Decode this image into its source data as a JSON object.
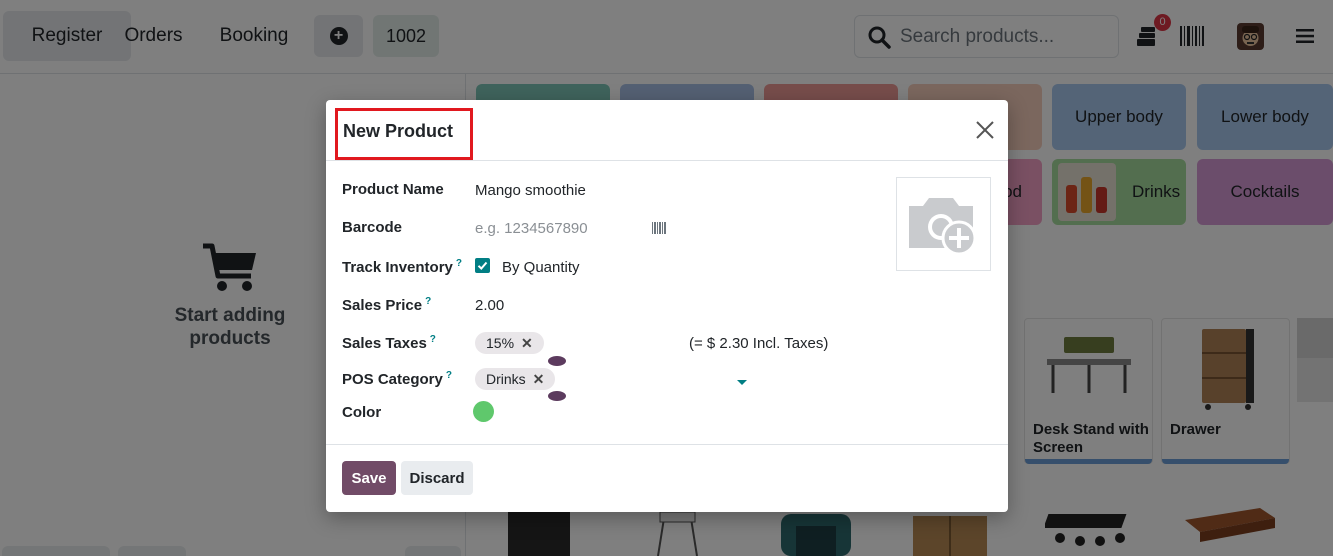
{
  "nav": {
    "register": "Register",
    "orders": "Orders",
    "booking": "Booking",
    "table_number": "1002",
    "search_placeholder": "Search products...",
    "order_badge": "0"
  },
  "cart": {
    "empty_line1": "Start adding",
    "empty_line2": "products"
  },
  "categories": {
    "upper_body": "Upper body",
    "lower_body": "Lower body",
    "food_partial": "od",
    "drinks": "Drinks",
    "cocktails": "Cocktails"
  },
  "products": {
    "desk_stand_line1": "Desk Stand with",
    "desk_stand_line2": "Screen",
    "drawer": "Drawer"
  },
  "modal": {
    "title": "New Product",
    "fields": {
      "product_name_label": "Product Name",
      "product_name_value": "Mango smoothie",
      "barcode_label": "Barcode",
      "barcode_placeholder": "e.g. 1234567890",
      "track_inventory_label": "Track Inventory",
      "track_inventory_option": "By Quantity",
      "track_inventory_checked": true,
      "sales_price_label": "Sales Price",
      "sales_price_value": "2.00",
      "sales_taxes_label": "Sales Taxes",
      "sales_taxes_tag": "15%",
      "incl_taxes_text": "(= $ 2.30 Incl. Taxes)",
      "pos_category_label": "POS Category",
      "pos_category_tag": "Drinks",
      "color_label": "Color",
      "color_value": "#5fc86c",
      "help_mark": "?",
      "tag_remove": "✕"
    },
    "save_label": "Save",
    "discard_label": "Discard"
  },
  "colors": {
    "primary": "#714b67",
    "accent": "#017e84",
    "highlight": "#e1181f"
  }
}
